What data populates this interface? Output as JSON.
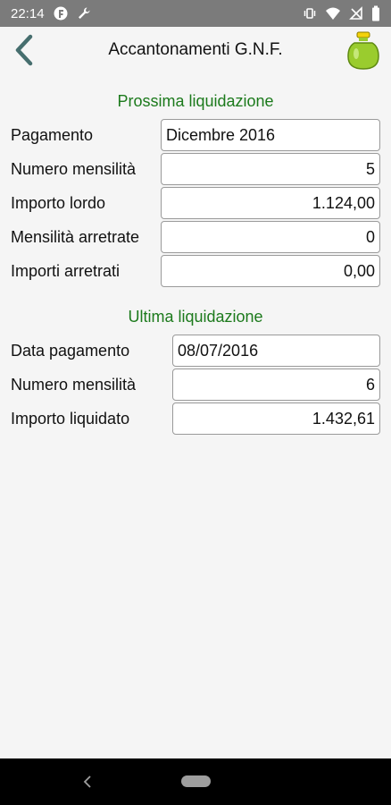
{
  "status_bar": {
    "time": "22:14",
    "icons": [
      "f-logo-icon",
      "wrench-icon",
      "vibrate-icon",
      "wifi-icon",
      "no-sim-icon",
      "battery-icon"
    ]
  },
  "app_bar": {
    "title": "Accantonamenti G.N.F.",
    "back_icon": "chevron-left-icon",
    "action_icon": "jar-icon"
  },
  "colors": {
    "section_title": "#1c7a1c",
    "back_chevron": "#466e6e",
    "jar": "#9acc2e"
  },
  "next_payout": {
    "title": "Prossima liquidazione",
    "fields": [
      {
        "label": "Pagamento",
        "value": "Dicembre 2016"
      },
      {
        "label": "Numero mensilità",
        "value": "5"
      },
      {
        "label": "Importo lordo",
        "value": "1.124,00"
      },
      {
        "label": "Mensilità arretrate",
        "value": "0"
      },
      {
        "label": "Importi arretrati",
        "value": "0,00"
      }
    ]
  },
  "last_payout": {
    "title": "Ultima liquidazione",
    "fields": [
      {
        "label": "Data pagamento",
        "value": "08/07/2016"
      },
      {
        "label": "Numero mensilità",
        "value": "6"
      },
      {
        "label": "Importo liquidato",
        "value": "1.432,61"
      }
    ]
  },
  "nav_bar": {
    "back_icon": "nav-back-icon",
    "home_icon": "home-pill-icon"
  }
}
